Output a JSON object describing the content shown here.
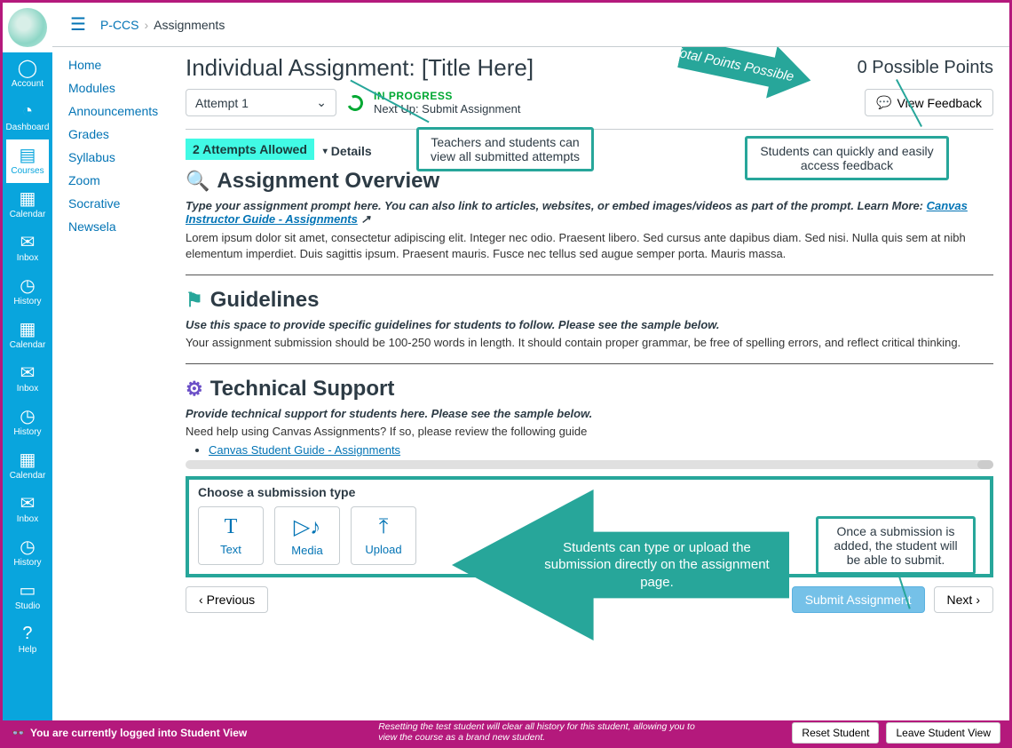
{
  "breadcrumb": {
    "course": "P-CCS",
    "page": "Assignments"
  },
  "global_nav": {
    "items": [
      {
        "label": "Account",
        "icon": "person"
      },
      {
        "label": "Dashboard",
        "icon": "gauge"
      },
      {
        "label": "Courses",
        "icon": "book"
      },
      {
        "label": "Calendar",
        "icon": "calendar"
      },
      {
        "label": "Inbox",
        "icon": "inbox"
      },
      {
        "label": "History",
        "icon": "clock"
      },
      {
        "label": "Calendar",
        "icon": "calendar"
      },
      {
        "label": "Inbox",
        "icon": "inbox"
      },
      {
        "label": "History",
        "icon": "clock"
      },
      {
        "label": "Calendar",
        "icon": "calendar"
      },
      {
        "label": "Inbox",
        "icon": "inbox"
      },
      {
        "label": "History",
        "icon": "clock"
      },
      {
        "label": "Studio",
        "icon": "studio"
      },
      {
        "label": "Help",
        "icon": "help"
      }
    ],
    "active_index": 2
  },
  "course_nav": {
    "items": [
      "Home",
      "Modules",
      "Announcements",
      "Grades",
      "Syllabus",
      "Zoom",
      "Socrative",
      "Newsela"
    ]
  },
  "page_title": "Individual Assignment: [Title Here]",
  "points_label": "0 Possible Points",
  "attempt": {
    "selected": "Attempt 1"
  },
  "progress": {
    "status": "IN PROGRESS",
    "next": "Next Up: Submit Assignment"
  },
  "view_feedback_label": "View Feedback",
  "attempts_badge": "2 Attempts Allowed",
  "details_label": "Details",
  "overview": {
    "heading": "Assignment Overview",
    "prompt": "Type your assignment prompt here. You can also link to articles, websites, or embed images/videos as part of the prompt. Learn More: ",
    "prompt_link": "Canvas Instructor Guide - Assignments",
    "body": "Lorem ipsum dolor sit amet, consectetur adipiscing elit. Integer nec odio. Praesent libero. Sed cursus ante dapibus diam. Sed nisi. Nulla quis sem at nibh elementum imperdiet. Duis sagittis ipsum. Praesent mauris. Fusce nec tellus sed augue semper porta. Mauris massa."
  },
  "guidelines": {
    "heading": "Guidelines",
    "prompt": "Use this space to provide specific guidelines for students to follow. Please see the sample below.",
    "body": "Your assignment submission should be 100-250 words in length. It should contain proper grammar, be free of spelling errors, and reflect critical thinking."
  },
  "tech": {
    "heading": "Technical Support",
    "prompt": "Provide technical support for students here. Please see the sample below.",
    "body": "Need help using Canvas Assignments? If so, please review the following guide",
    "link": "Canvas Student Guide - Assignments"
  },
  "submission": {
    "title": "Choose a submission type",
    "types": [
      {
        "label": "Text",
        "icon": "T"
      },
      {
        "label": "Media",
        "icon": "▷♪"
      },
      {
        "label": "Upload",
        "icon": "⤒"
      }
    ]
  },
  "foot": {
    "prev": "Previous",
    "submit": "Submit Assignment",
    "next": "Next"
  },
  "sv_bar": {
    "text": "You are currently logged into Student View",
    "note": "Resetting the test student will clear all history for this student, allowing you to view the course as a brand new student.",
    "reset": "Reset Student",
    "leave": "Leave Student View"
  },
  "annotations": {
    "points_arrow": "Total Points Possible",
    "attempts_box": "Teachers and students can view all submitted attempts",
    "feedback_box": "Students can quickly and easily access feedback",
    "submission_arrow": "Students can type or upload the submission directly on the assignment page.",
    "submit_box": "Once a submission is added, the student will be able to submit."
  }
}
